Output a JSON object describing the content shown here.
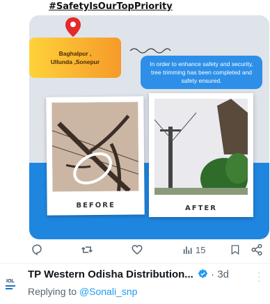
{
  "post": {
    "hashtag": "#SafetyIsOurTopPriority",
    "location_line1": "Baghalpur ,",
    "location_line2": "Ullunda ,Sonepur",
    "info_text": "In order to enhance safety and security, tree trimming has been completed and safety ensured.",
    "before_caption": "BEFORE",
    "after_caption": "AFTER"
  },
  "actions": {
    "views_count": "15"
  },
  "next_tweet": {
    "author": "TP Western Odisha Distribution...",
    "time_sep": "·",
    "time": "3d",
    "reply_prefix": "Replying to",
    "reply_handle": "@Sonali_snp",
    "avatar_text": "IOL"
  },
  "colors": {
    "accent_blue": "#1d9bf0",
    "verified_blue": "#1d9bf0",
    "banner_blue": "#1f86e0"
  }
}
